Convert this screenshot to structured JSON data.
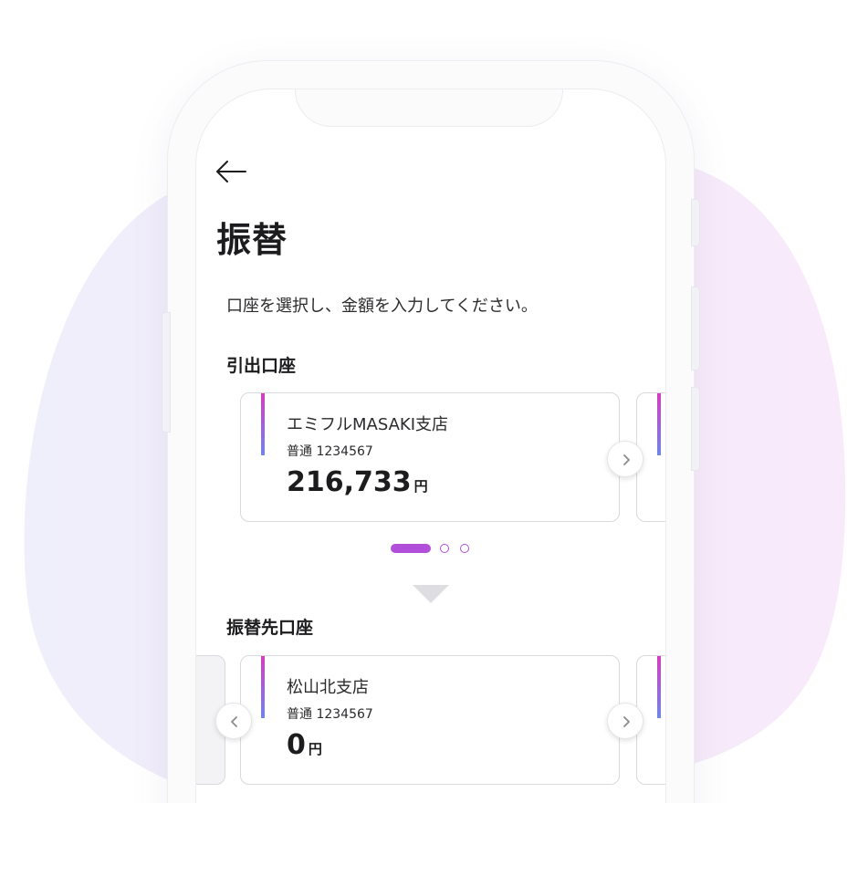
{
  "header": {
    "back_icon": "arrow-left-icon",
    "title": "振替"
  },
  "instruction": "口座を選択し、金額を入力してください。",
  "withdrawal": {
    "section_title": "引出口座",
    "account": {
      "branch": "エミフルMASAKI支店",
      "account_line": "普通 1234567",
      "amount": "216,733",
      "unit": "円"
    },
    "carousel": {
      "active_index": 0,
      "count": 3
    }
  },
  "transfer_to": {
    "section_title": "振替先口座",
    "account": {
      "branch": "松山北支店",
      "account_line": "普通 1234567",
      "amount": "0",
      "unit": "円"
    }
  },
  "colors": {
    "accent": "#b14fdb",
    "gradient_top": "#d63dc0",
    "gradient_bottom": "#6f86e8"
  },
  "icons": {
    "next": "chevron-right-icon",
    "prev": "chevron-left-icon",
    "flow": "triangle-down-icon"
  }
}
